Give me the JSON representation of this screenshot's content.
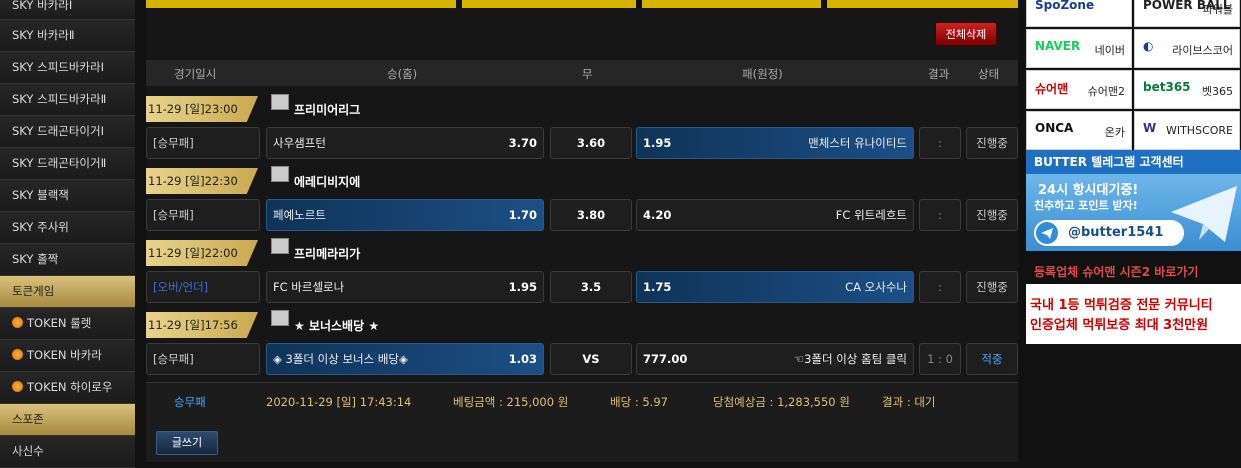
{
  "sidebar": {
    "items": [
      {
        "label": "SKY 바카라Ⅰ",
        "style": "dark"
      },
      {
        "label": "SKY 바카라Ⅱ",
        "style": "dark"
      },
      {
        "label": "SKY 스피드바카라Ⅰ",
        "style": "dark"
      },
      {
        "label": "SKY 스피드바카라Ⅱ",
        "style": "dark"
      },
      {
        "label": "SKY 드래곤타이거Ⅰ",
        "style": "dark"
      },
      {
        "label": "SKY 드래곤타이거Ⅱ",
        "style": "dark"
      },
      {
        "label": "SKY 블랙잭",
        "style": "dark"
      },
      {
        "label": "SKY 주사위",
        "style": "dark"
      },
      {
        "label": "SKY 홀짝",
        "style": "dark"
      },
      {
        "label": "토큰게임",
        "style": "gold"
      },
      {
        "label": "TOKEN 룰렛",
        "style": "coin"
      },
      {
        "label": "TOKEN 바카라",
        "style": "coin"
      },
      {
        "label": "TOKEN 하이로우",
        "style": "coin"
      },
      {
        "label": "스포존",
        "style": "gold"
      },
      {
        "label": "사신수",
        "style": "dark"
      }
    ]
  },
  "main": {
    "delete_all_label": "전체삭제",
    "headers": {
      "date": "경기일시",
      "home": "승(홈)",
      "draw": "무",
      "away": "패(원정)",
      "result": "결과",
      "status": "상태"
    },
    "games": [
      {
        "datetime": "11-29 [일]23:00",
        "league": "프리미어리그",
        "type": "[승무패]",
        "home_team": "사우샘프턴",
        "home_odds": "3.70",
        "draw": "3.60",
        "away_odds": "1.95",
        "away_team": "맨체스터 유나이티드",
        "selected": "away",
        "result": ":",
        "status": "진행중"
      },
      {
        "datetime": "11-29 [일]22:30",
        "league": "에레디비지에",
        "type": "[승무패]",
        "home_team": "페예노르트",
        "home_odds": "1.70",
        "draw": "3.80",
        "away_odds": "4.20",
        "away_team": "FC 위트레흐트",
        "selected": "home",
        "result": ":",
        "status": "진행중"
      },
      {
        "datetime": "11-29 [일]22:00",
        "league": "프리메라리가",
        "type": "[오버/언더]",
        "home_team": "FC 바르셀로나",
        "home_odds": "1.95",
        "draw": "3.5",
        "away_odds": "1.75",
        "away_team": "CA 오사수나",
        "selected": "away",
        "result": ":",
        "status": "진행중"
      },
      {
        "datetime": "11-29 [일]17:56",
        "league": "★ 보너스배당 ★",
        "type": "[승무패]",
        "home_team": "◈ 3폴더 이상 보너스 배당◈",
        "home_odds": "1.03",
        "draw": "VS",
        "away_odds": "777.00",
        "away_team": "☜3폴더 이상 홈팀 클릭",
        "selected": "home",
        "result": "1 : 0",
        "status": "적중"
      }
    ],
    "summary": {
      "bet_type": "승무패",
      "timestamp": "2020-11-29 [일] 17:43:14",
      "bet_amount": "베팅금액 : 215,000 원",
      "odds": "배당 : 5.97",
      "expected": "당첨예상금 : 1,283,550 원",
      "result": "결과 : 대기"
    },
    "write_label": "글쓰기"
  },
  "right": {
    "partners": [
      {
        "logo": "SpoZone",
        "name": ""
      },
      {
        "logo": "POWER BALL",
        "name": "파워볼"
      },
      {
        "logo": "NAVER",
        "name": "네이버"
      },
      {
        "logo": "◐",
        "name": "라이브스코어"
      },
      {
        "logo": "슈어맨",
        "name": "슈어맨2"
      },
      {
        "logo": "bet365",
        "name": "벳365"
      },
      {
        "logo": "ONCA",
        "name": "온카"
      },
      {
        "logo": "W",
        "name": "WITHSCORE"
      }
    ],
    "telegram": {
      "title": "BUTTER 텔레그램 고객센터",
      "line1": "24시 항시대기중!",
      "line2": "친추하고 포인트 받자!",
      "handle": "@butter1541"
    },
    "ad": {
      "title": "등록업체 슈어맨 시즌2 바로가기",
      "line1": "국내 1등 먹튀검증 전문 커뮤니티",
      "line2": "인증업체 먹튀보증 최대 3천만원"
    }
  }
}
